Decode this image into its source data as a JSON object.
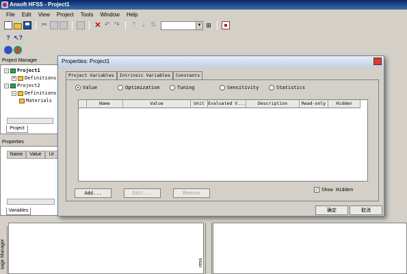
{
  "app": {
    "title": "Ansoft HFSS - Project1"
  },
  "menu": [
    "File",
    "Edit",
    "View",
    "Project",
    "Tools",
    "Window",
    "Help"
  ],
  "project_manager": {
    "title": "Project Manager",
    "tree": [
      {
        "label": "Project1",
        "level": 0,
        "bold": true
      },
      {
        "label": "Definitions",
        "level": 1,
        "bold": false
      },
      {
        "label": "Project2",
        "level": 0,
        "bold": false
      },
      {
        "label": "Definitions",
        "level": 1,
        "bold": false
      },
      {
        "label": "Materials",
        "level": 2,
        "bold": false
      }
    ],
    "tab_label": "Project"
  },
  "properties_pane": {
    "title": "Properties",
    "columns": [
      "Name",
      "Value",
      "Ur"
    ],
    "tab_label": "Variables"
  },
  "side_labels": {
    "left": "sage Manager",
    "right": "ress"
  },
  "dialog": {
    "title": "Properties: Project1",
    "tabs": [
      "Project Variables",
      "Intrinsic Variables",
      "Constants"
    ],
    "active_tab": 0,
    "radios": [
      {
        "label": "Value",
        "selected": true
      },
      {
        "label": "Optimization",
        "selected": false
      },
      {
        "label": "Tuning",
        "selected": false
      },
      {
        "label": "Sensitivity",
        "selected": false
      },
      {
        "label": "Statistics",
        "selected": false
      }
    ],
    "columns": [
      "",
      "Name",
      "Value",
      "Unit",
      "Evaluated V...",
      "Description",
      "Read-only",
      "Hidden"
    ],
    "add_label": "Add...",
    "edit_label": "Edit...",
    "remove_label": "Remove",
    "show_hidden_label": "Show Hidden",
    "show_hidden_checked": true,
    "ok_label": "确定",
    "cancel_label": "取消"
  }
}
